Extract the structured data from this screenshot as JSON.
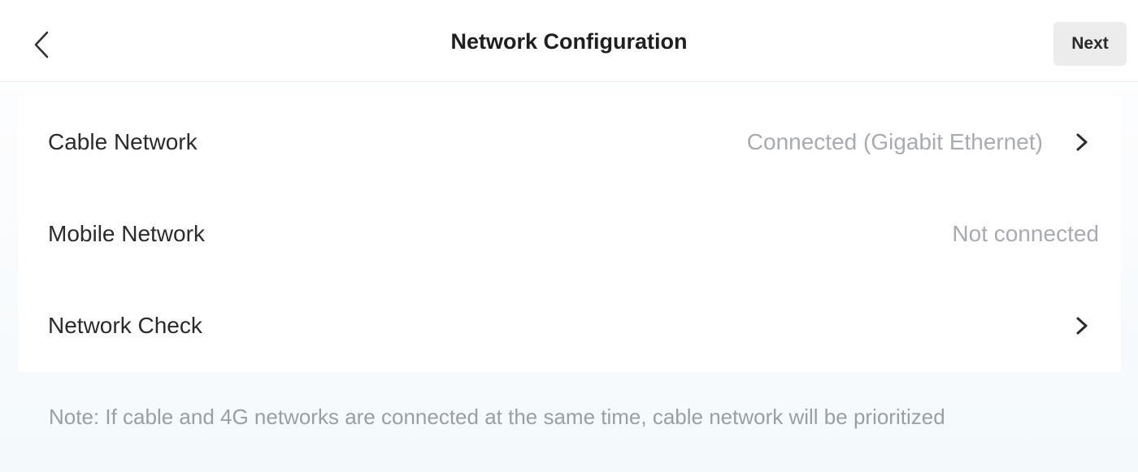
{
  "header": {
    "title": "Network Configuration",
    "next_label": "Next"
  },
  "settings": {
    "rows": [
      {
        "label": "Cable Network",
        "value": "Connected (Gigabit Ethernet)",
        "has_chevron": true
      },
      {
        "label": "Mobile Network",
        "value": "Not connected",
        "has_chevron": false
      },
      {
        "label": "Network Check",
        "value": "",
        "has_chevron": true
      }
    ]
  },
  "note": "Note: If cable and 4G networks are connected at the same time, cable network will be prioritized",
  "icons": {
    "back": "chevron-left-icon",
    "row_arrow": "chevron-right-icon"
  },
  "colors": {
    "title": "#1f1f1f",
    "label": "#2b2b2b",
    "value": "#a9abae",
    "note": "#9c9ea1",
    "next_button_bg": "#ececec"
  }
}
